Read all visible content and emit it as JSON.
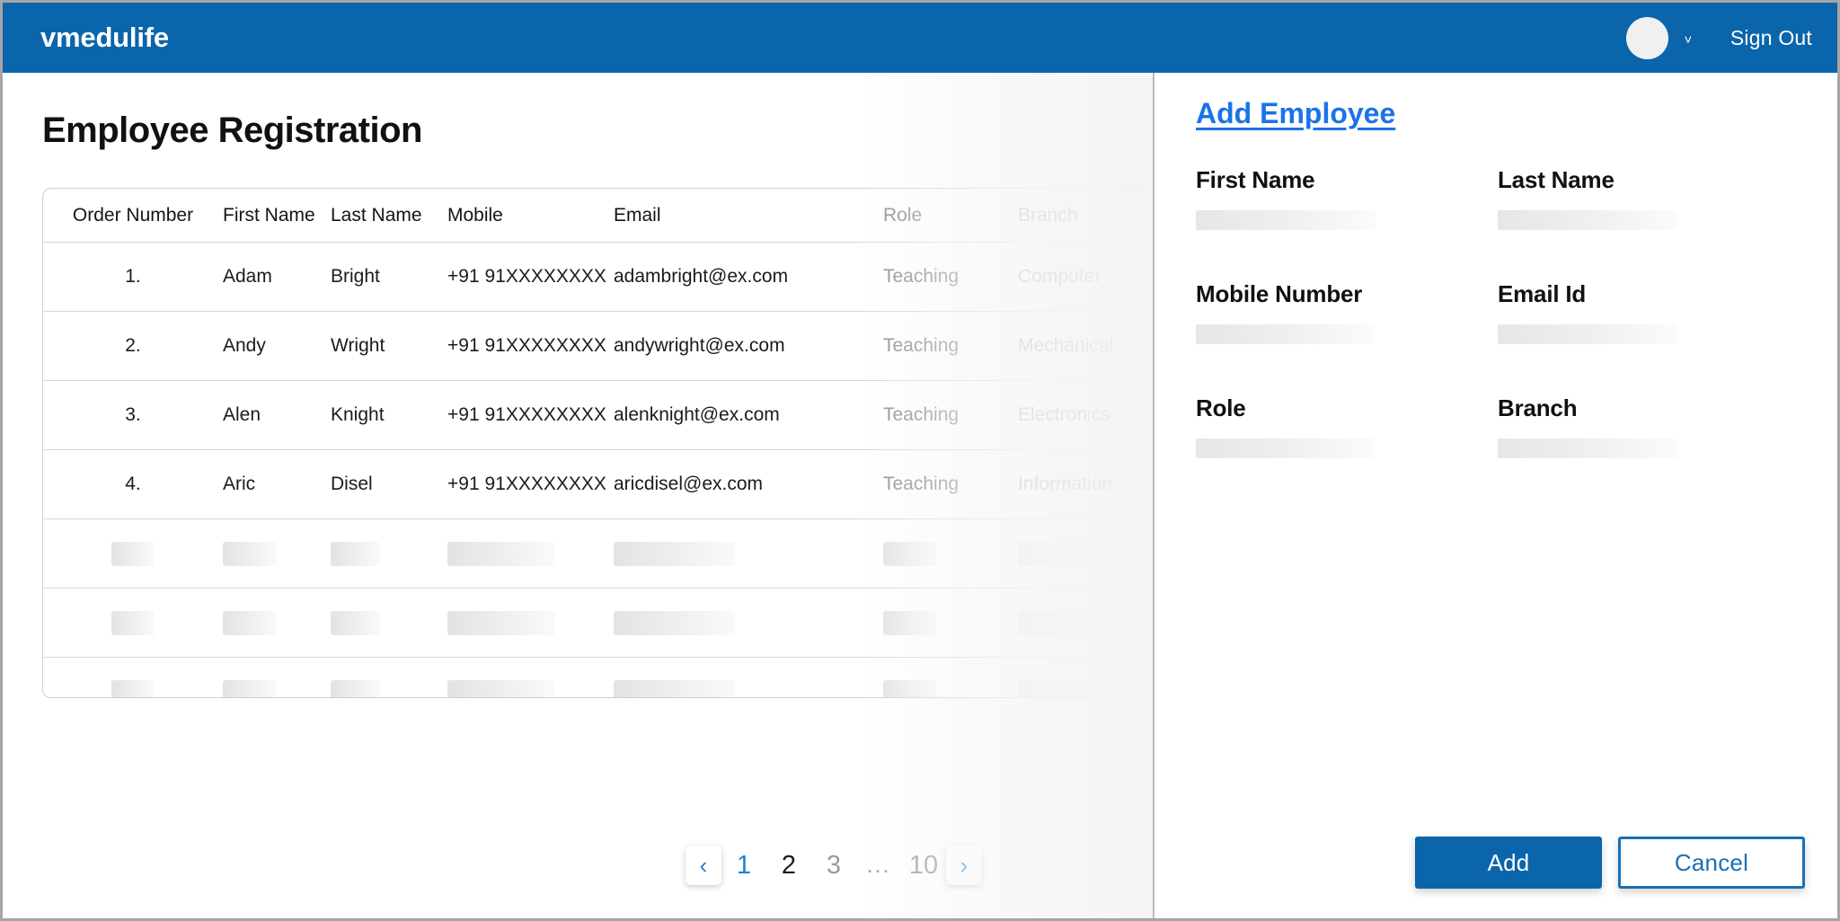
{
  "header": {
    "brand": "vmedulife",
    "sign_out_label": "Sign Out",
    "avatar_name": "user-avatar",
    "chevron": "˅",
    "background_color": "#0a65ab"
  },
  "page": {
    "title": "Employee Registration"
  },
  "table": {
    "columns": [
      {
        "key": "order",
        "label": "Order Number"
      },
      {
        "key": "first",
        "label": "First Name"
      },
      {
        "key": "last",
        "label": "Last Name"
      },
      {
        "key": "mobile",
        "label": "Mobile"
      },
      {
        "key": "email",
        "label": "Email"
      },
      {
        "key": "role",
        "label": "Role"
      },
      {
        "key": "branch",
        "label": "Branch"
      }
    ],
    "rows": [
      {
        "order": "1.",
        "first": "Adam",
        "last": "Bright",
        "mobile": "+91 91XXXXXXXX",
        "email": "adambright@ex.com",
        "role": "Teaching",
        "branch": "Computer"
      },
      {
        "order": "2.",
        "first": "Andy",
        "last": "Wright",
        "mobile": "+91 91XXXXXXXX",
        "email": "andywright@ex.com",
        "role": "Teaching",
        "branch": "Mechanical"
      },
      {
        "order": "3.",
        "first": "Alen",
        "last": "Knight",
        "mobile": "+91 91XXXXXXXX",
        "email": "alenknight@ex.com",
        "role": "Teaching",
        "branch": "Electronics"
      },
      {
        "order": "4.",
        "first": "Aric",
        "last": "Disel",
        "mobile": "+91 91XXXXXXXX",
        "email": "aricdisel@ex.com",
        "role": "Teaching",
        "branch": "Information"
      }
    ],
    "placeholder_row_count": 4
  },
  "pagination": {
    "prev_icon": "‹",
    "next_icon": "›",
    "items": [
      {
        "label": "1",
        "state": "active"
      },
      {
        "label": "2",
        "state": "dark"
      },
      {
        "label": "3",
        "state": "muted"
      },
      {
        "label": "...",
        "state": "ellipsis"
      },
      {
        "label": "10",
        "state": "muted"
      }
    ]
  },
  "panel": {
    "title": "Add Employee",
    "fields": [
      {
        "label": "First Name",
        "value": ""
      },
      {
        "label": "Last Name",
        "value": ""
      },
      {
        "label": "Mobile Number",
        "value": ""
      },
      {
        "label": "Email Id",
        "value": ""
      },
      {
        "label": "Role",
        "value": ""
      },
      {
        "label": "Branch",
        "value": ""
      }
    ],
    "add_label": "Add",
    "cancel_label": "Cancel",
    "accent_color": "#0a65ab",
    "link_color": "#1a73e8"
  }
}
